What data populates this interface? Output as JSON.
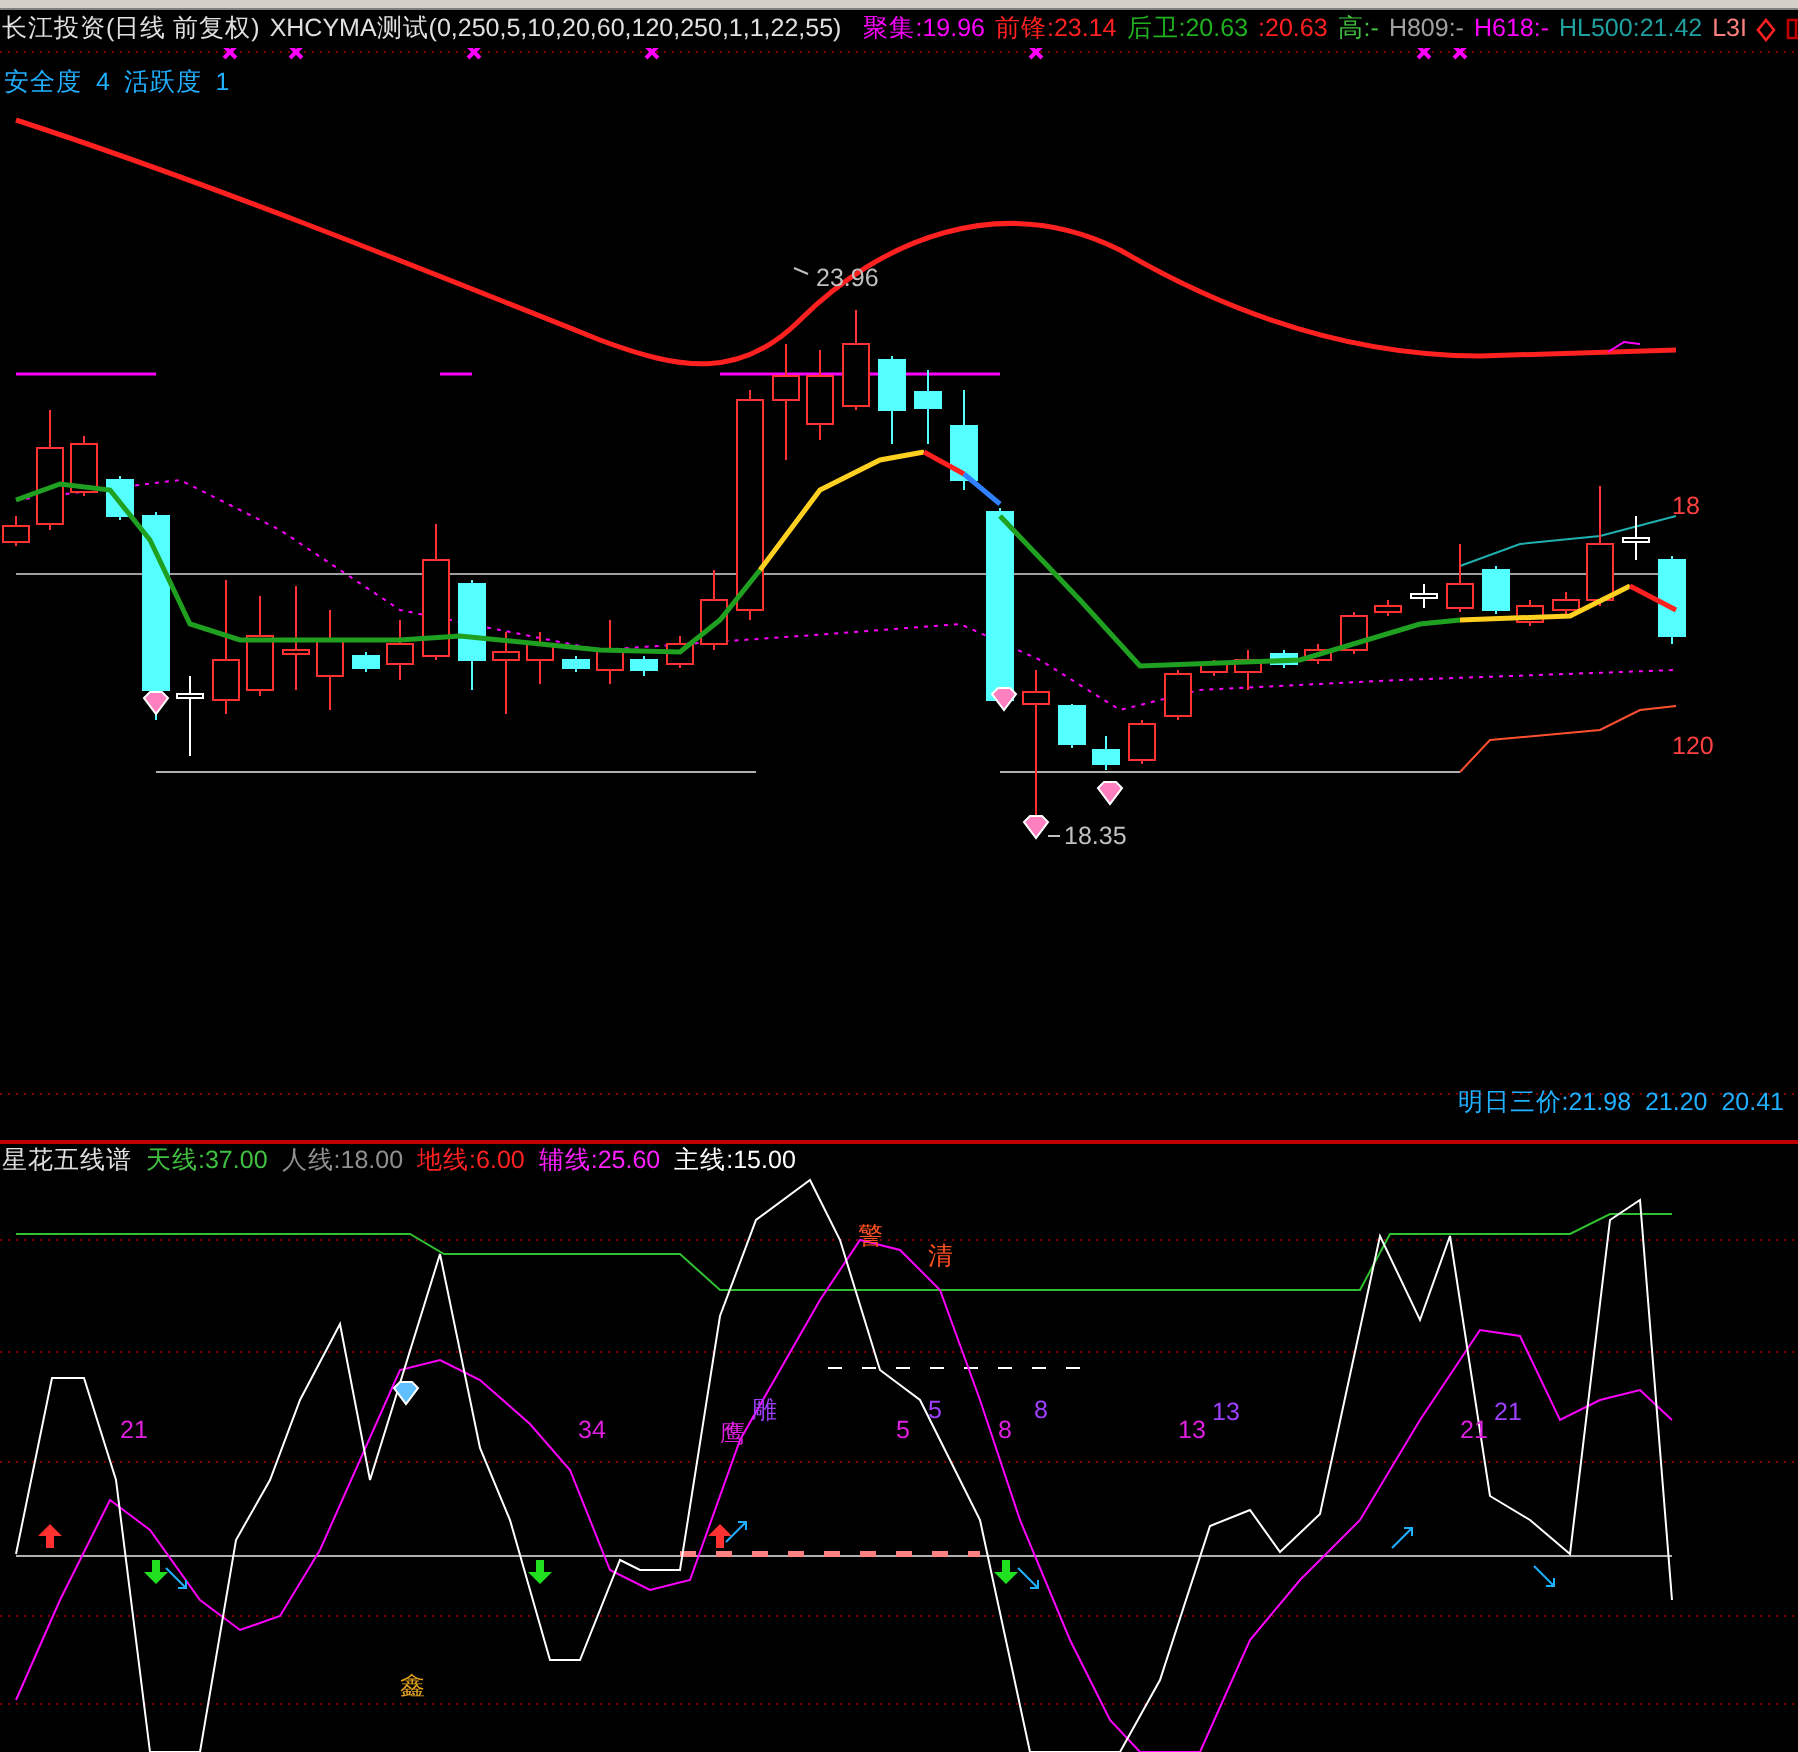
{
  "header": {
    "title": "长江投资(日线 前复权)",
    "indicator": "XHCYMA测试(0,250,5,10,20,60,120,250,1,1,22,55)",
    "values": [
      {
        "label": "聚集:",
        "value": "19.96",
        "color": "#ff00ff"
      },
      {
        "label": "前锋:",
        "value": "23.14",
        "color": "#ff2020"
      },
      {
        "label": "后卫:",
        "value": "20.63",
        "color": "#20b020"
      },
      {
        "label": ":",
        "value": "20.63",
        "color": "#ff2020"
      },
      {
        "label": "高:",
        "value": "-",
        "color": "#40c040"
      },
      {
        "label": "H809:",
        "value": "-",
        "color": "#a0a0a0"
      },
      {
        "label": "H618:",
        "value": "-",
        "color": "#ff00ff"
      },
      {
        "label": "HL500:",
        "value": "21.42",
        "color": "#20a0a0"
      }
    ],
    "cut_label": "L3I"
  },
  "safety": "安全度  4  活跃度  1",
  "main_chart": {
    "labels": [
      "23.96",
      "18",
      "120",
      "18.35"
    ],
    "forecast": "明日三价:21.98  21.20  20.41"
  },
  "lower_header": {
    "name": "星花五线谱",
    "values": [
      {
        "label": "天线:",
        "value": "37.00",
        "color": "#40c040"
      },
      {
        "label": "人线:",
        "value": "18.00",
        "color": "#909090"
      },
      {
        "label": "地线:",
        "value": "6.00",
        "color": "#ff2020"
      },
      {
        "label": "辅线:",
        "value": "25.60",
        "color": "#ff20ff"
      },
      {
        "label": "主线:",
        "value": "15.00",
        "color": "#ffffff"
      }
    ]
  },
  "lower_chart": {
    "labels": [
      {
        "text": "警",
        "color": "#ff5020"
      },
      {
        "text": "清",
        "color": "#ff5020"
      },
      {
        "text": "21",
        "color": "#e020e0"
      },
      {
        "text": "34",
        "color": "#e020e0"
      },
      {
        "text": "鹰",
        "color": "#e020e0"
      },
      {
        "text": "雕",
        "color": "#a040ff"
      },
      {
        "text": "5",
        "color": "#e020e0"
      },
      {
        "text": "5",
        "color": "#a040ff"
      },
      {
        "text": "8",
        "color": "#e020e0"
      },
      {
        "text": "8",
        "color": "#a040ff"
      },
      {
        "text": "13",
        "color": "#e020e0"
      },
      {
        "text": "13",
        "color": "#a040ff"
      },
      {
        "text": "21",
        "color": "#e020e0"
      },
      {
        "text": "21",
        "color": "#a040ff"
      },
      {
        "text": "鑫",
        "color": "#e0a020"
      }
    ]
  }
}
